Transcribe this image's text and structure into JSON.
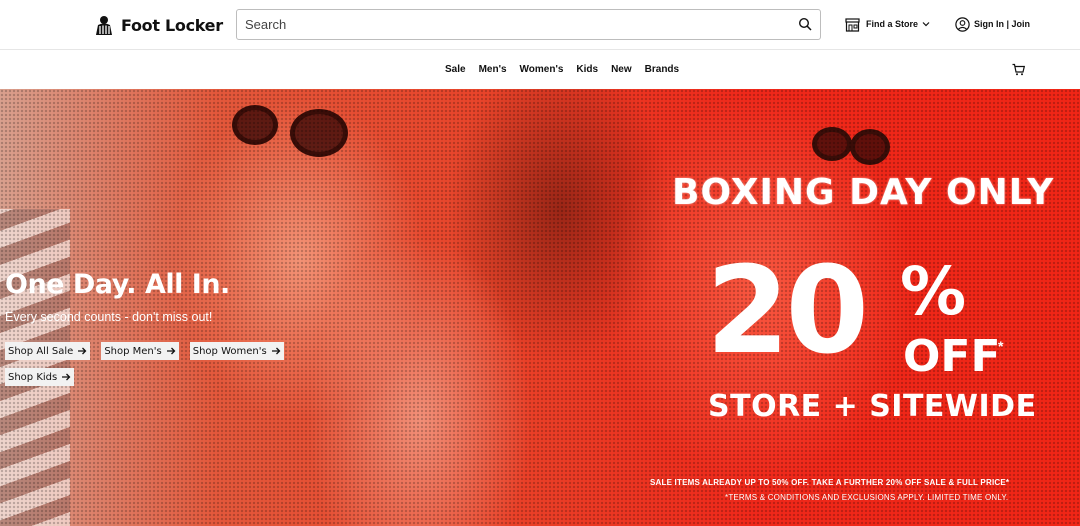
{
  "header": {
    "logo_text": "Foot Locker",
    "search": {
      "placeholder": "Search",
      "value": ""
    },
    "find_store_label": "Find a Store",
    "signin_label": "Sign In | Join"
  },
  "nav": {
    "items": [
      {
        "label": "Sale"
      },
      {
        "label": "Men's"
      },
      {
        "label": "Women's"
      },
      {
        "label": "Kids"
      },
      {
        "label": "New"
      },
      {
        "label": "Brands"
      }
    ],
    "cart_icon": "cart-icon"
  },
  "hero": {
    "title": "One Day. All In.",
    "subtitle": "Every second counts - don't miss out!",
    "ctas": [
      {
        "label": "Shop All Sale"
      },
      {
        "label": "Shop Men's"
      },
      {
        "label": "Shop Women's"
      },
      {
        "label": "Shop Kids"
      }
    ],
    "promo": {
      "headline": "BOXING DAY ONLY",
      "percent": "20",
      "percent_sign": "%",
      "off": "OFF",
      "asterisk": "*",
      "scope": "STORE + SITEWIDE",
      "fine_print_1": "SALE ITEMS ALREADY UP TO 50% OFF. TAKE A FURTHER 20% OFF SALE & FULL PRICE*",
      "fine_print_2": "*TERMS & CONDITIONS AND EXCLUSIONS APPLY. LIMITED TIME ONLY."
    }
  },
  "colors": {
    "hero_red": "#f12616",
    "text_dark": "#111111",
    "cta_bg": "#f2f2f2"
  }
}
